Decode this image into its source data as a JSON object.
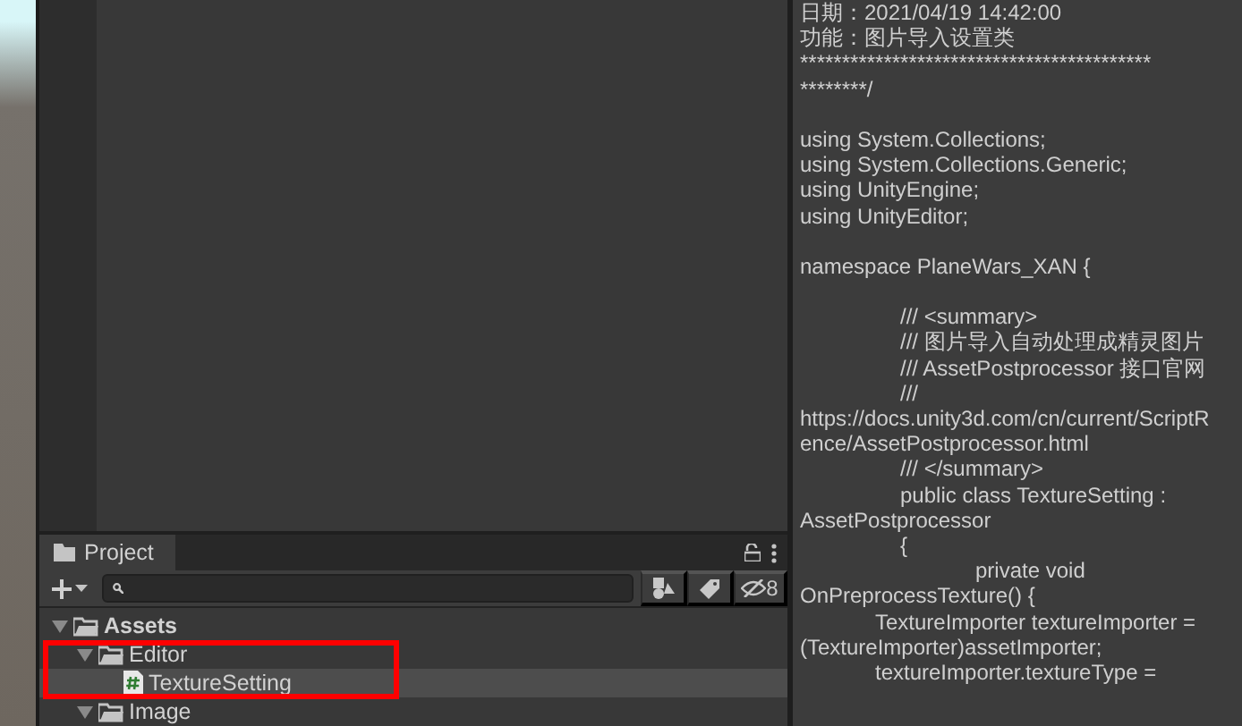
{
  "code_panel": {
    "lines": [
      {
        "kind": "code",
        "text": "日期：2021/04/19 14:42:00"
      },
      {
        "kind": "code",
        "text": "功能：图片导入设置类"
      },
      {
        "kind": "code",
        "text": "******************************************"
      },
      {
        "kind": "code",
        "text": "********/"
      },
      {
        "kind": "blank"
      },
      {
        "kind": "code",
        "text": "using System.Collections;"
      },
      {
        "kind": "code",
        "text": "using System.Collections.Generic;"
      },
      {
        "kind": "code",
        "text": "using UnityEngine;"
      },
      {
        "kind": "code",
        "text": "using UnityEditor;"
      },
      {
        "kind": "blank"
      },
      {
        "kind": "code",
        "text": "namespace PlaneWars_XAN {"
      },
      {
        "kind": "blank"
      },
      {
        "kind": "code",
        "text": "\t\t\t\t/// <summary>"
      },
      {
        "kind": "code",
        "text": "\t\t\t\t/// 图片导入自动处理成精灵图片"
      },
      {
        "kind": "code",
        "text": "\t\t\t\t/// AssetPostprocessor 接口官网"
      },
      {
        "kind": "code",
        "text": "\t\t\t\t///"
      },
      {
        "kind": "code",
        "text": "https://docs.unity3d.com/cn/current/ScriptR"
      },
      {
        "kind": "code",
        "text": "ence/AssetPostprocessor.html"
      },
      {
        "kind": "code",
        "text": "\t\t\t\t/// </summary>"
      },
      {
        "kind": "code",
        "text": "\t\t\t\tpublic class TextureSetting :"
      },
      {
        "kind": "code",
        "text": "AssetPostprocessor"
      },
      {
        "kind": "code",
        "text": "\t\t\t\t{"
      },
      {
        "kind": "code",
        "text": "\t\t\t\t\t\t\tprivate void"
      },
      {
        "kind": "code",
        "text": "OnPreprocessTexture() {"
      },
      {
        "kind": "code",
        "text": "\t\t\tTextureImporter textureImporter ="
      },
      {
        "kind": "code",
        "text": "(TextureImporter)assetImporter;"
      },
      {
        "kind": "code",
        "text": "\t\t\ttextureImporter.textureType ="
      }
    ]
  },
  "project_panel": {
    "tab": {
      "label": "Project",
      "selected": true
    },
    "hidden_count": "8",
    "tree": [
      {
        "label": "Assets",
        "kind": "folder",
        "expanded": true,
        "selected": false,
        "children": [
          {
            "label": "Editor",
            "kind": "folder",
            "expanded": true,
            "selected": false,
            "children": [
              {
                "label": "TextureSetting",
                "kind": "script",
                "selected": true
              }
            ]
          },
          {
            "label": "Image",
            "kind": "folder",
            "expanded": true,
            "selected": false
          }
        ]
      }
    ]
  }
}
